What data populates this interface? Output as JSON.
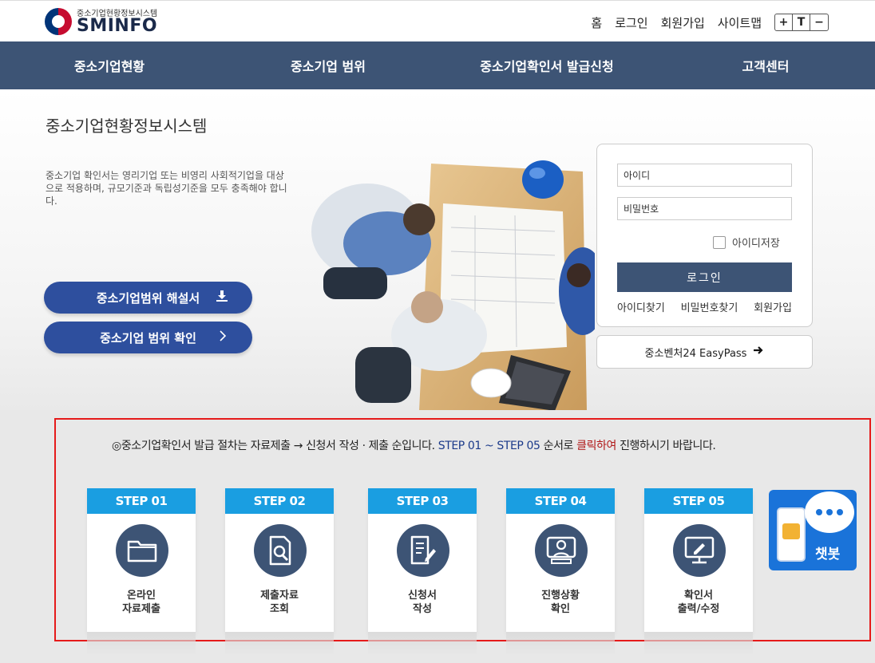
{
  "header": {
    "logo_sub": "중소기업현황정보시스템",
    "logo_main": "SMINFO",
    "links": [
      "홈",
      "로그인",
      "회원가입",
      "사이트맵"
    ],
    "font_controls": [
      "+",
      "T",
      "−"
    ]
  },
  "nav": {
    "items": [
      "중소기업현황",
      "중소기업 범위",
      "중소기업확인서 발급신청",
      "고객센터"
    ]
  },
  "hero": {
    "title": "중소기업현황정보시스템",
    "description": "중소기업 확인서는 영리기업 또는 비영리 사회적기업을 대상으로 적용하며, 규모기준과 독립성기준을 모두 충족해야 합니다.",
    "button_guide": "중소기업범위 해설서",
    "button_check": "중소기업 범위 확인"
  },
  "login": {
    "id_placeholder": "아이디",
    "pw_placeholder": "비밀번호",
    "save_id": "아이디저장",
    "login_button": "로그인",
    "find_id": "아이디찾기",
    "find_pw": "비밀번호찾기",
    "signup": "회원가입",
    "easypass": "중소벤처24 EasyPass"
  },
  "notice": {
    "part1": "◎중소기업확인서 발급 절차는 자료제출 → 신청서 작성 · 제출 순입니다. ",
    "part2": "STEP 01 ~ STEP 05",
    "part3": " 순서로 ",
    "part4": "클릭하여",
    "part5": " 진행하시기 바랍니다."
  },
  "steps": [
    {
      "title": "STEP 01",
      "line1": "온라인",
      "line2": "자료제출",
      "icon": "folder-icon"
    },
    {
      "title": "STEP 02",
      "line1": "제출자료",
      "line2": "조회",
      "icon": "document-search-icon"
    },
    {
      "title": "STEP 03",
      "line1": "신청서",
      "line2": "작성",
      "icon": "document-edit-icon"
    },
    {
      "title": "STEP 04",
      "line1": "진행상황",
      "line2": "확인",
      "icon": "monitor-user-icon"
    },
    {
      "title": "STEP 05",
      "line1": "확인서",
      "line2": "출력/수정",
      "icon": "monitor-edit-icon"
    }
  ],
  "chatbot": {
    "label": "챗봇"
  },
  "colors": {
    "nav_bg": "#3d5475",
    "step_header": "#1a9ee1",
    "pill_button": "#2e4f9e",
    "highlight_frame": "#e51a1a",
    "chatbot_bg": "#1a73d9"
  }
}
